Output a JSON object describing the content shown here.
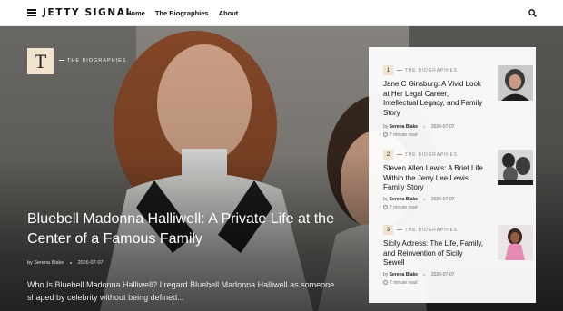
{
  "header": {
    "logo": "JETTY SIGNAL",
    "nav": [
      "Home",
      "The Biographies",
      "About"
    ]
  },
  "hero": {
    "category_letter": "T",
    "category": "THE BIOGRAPHIES",
    "title": "Bluebell Madonna Halliwell: A Private Life at the Center of a Famous Family",
    "author_prefix": "by",
    "author": "Serena Blake",
    "date": "2026-07-07",
    "excerpt": "Who Is Bluebell Madonna Halliwell? I regard Bluebell Madonna Halliwell as someone shaped by celebrity without being defined..."
  },
  "sidebar": {
    "items": [
      {
        "number": "1",
        "category": "THE BIOGRAPHIES",
        "title": "Jane C Ginsburg: A Vivid Look at Her Legal Career, Intellectual Legacy, and Family Story",
        "by": "by",
        "author": "Serena Blake",
        "date": "2026-07-07",
        "read_time": "7 minute read"
      },
      {
        "number": "2",
        "category": "THE BIOGRAPHIES",
        "title": "Steven Allen Lewis: A Brief Life Within the Jerry Lee Lewis Family Story",
        "by": "by",
        "author": "Serena Blake",
        "date": "2026-07-07",
        "read_time": "7 minute read"
      },
      {
        "number": "3",
        "category": "THE BIOGRAPHIES",
        "title": "Sicily Actress: The Life, Family, and Reinvention of Sicily Sewell",
        "by": "by",
        "author": "Serena Blake",
        "date": "2026-07-07",
        "read_time": "7 minute read"
      }
    ]
  },
  "colors": {
    "accent": "#f2e3cf"
  }
}
